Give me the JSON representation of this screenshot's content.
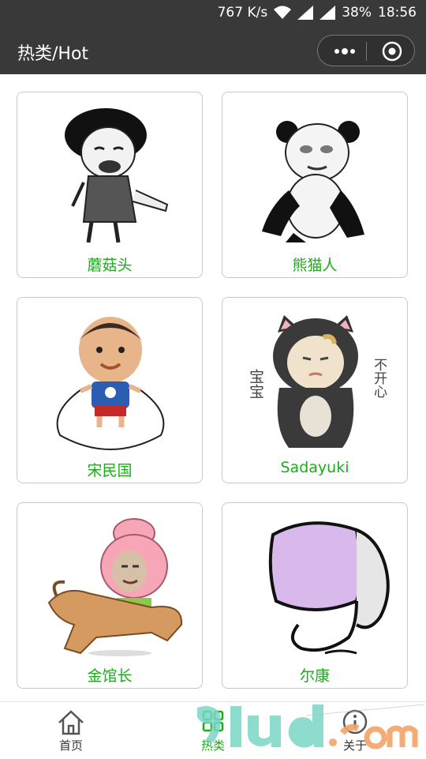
{
  "status_bar": {
    "network_speed": "767 K/s",
    "battery": "38%",
    "time": "18:56"
  },
  "nav": {
    "title": "热类/Hot",
    "more_icon": "more-dots-icon",
    "close_icon": "target-close-icon"
  },
  "cards": [
    {
      "label": "蘑菇头"
    },
    {
      "label": "熊猫人"
    },
    {
      "label": "宋民国"
    },
    {
      "label": "Sadayuki",
      "sticker_left": "宝宝",
      "sticker_right": "不开心"
    },
    {
      "label": "金馆长"
    },
    {
      "label": "尔康"
    }
  ],
  "tabs": [
    {
      "label": "首页",
      "icon": "home-icon"
    },
    {
      "label": "热类",
      "icon": "grid-icon"
    },
    {
      "label": "关于",
      "icon": "info-icon"
    }
  ],
  "colors": {
    "bar": "#393939",
    "accent": "#1aad19",
    "card_border": "#c9c9c9"
  }
}
